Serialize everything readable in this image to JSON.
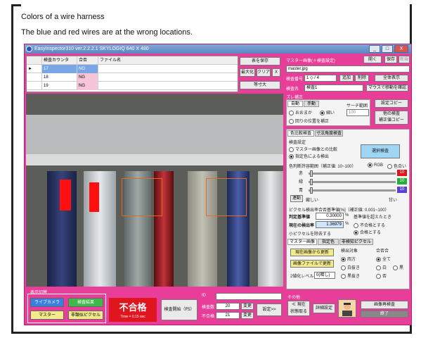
{
  "caption": {
    "line1": "Colors of a wire harness",
    "line2": "The blue and red wires are at the wrong locations."
  },
  "window": {
    "title": "EasyInspector310 ver.2.2.2.1 SKYLOGIQ 640 X 480",
    "min": "_",
    "max": "□",
    "close": "X"
  },
  "grid": {
    "headers": [
      "",
      "検査カウンタ",
      "合否",
      "ファイル名"
    ],
    "rows": [
      {
        "marker": "►",
        "counter": "17",
        "result": "NG",
        "file": ""
      },
      {
        "marker": "",
        "counter": "18",
        "result": "NG",
        "file": ""
      },
      {
        "marker": "",
        "counter": "19",
        "result": "NG",
        "file": ""
      }
    ]
  },
  "image_toolbar": {
    "save": "表を保存",
    "zoom": "最大化",
    "clear": "クリア",
    "x": "X",
    "scale": "等寸大"
  },
  "bottom": {
    "display_switch_label": "表示切替",
    "live": "ライブカメラ",
    "inspect_result": "検査結果",
    "master": "マスター",
    "mismatch_pixels": "非類似ピクセル",
    "result_text": "不合格",
    "time_text": "Time = 0.15 sec",
    "start_button": "検査開始（F5）",
    "id_label": "ID",
    "count_label": "検査数",
    "count_value": "20",
    "ng_label": "不合格",
    "ng_value": "21",
    "fix1": "変更",
    "fix2": "変更",
    "settings": "設定>>"
  },
  "right": {
    "master_image_label": "マスター画像(＋検査設定)",
    "open": "開く",
    "save": "保存",
    "new": "新規",
    "file": "master.jpg",
    "insp_no_label": "検査番号",
    "insp_no": "1 ◇ / 4",
    "add": "追加",
    "delete": "削除",
    "show_all": "全体表示",
    "insp_name_label": "検査名",
    "insp_name": "検査1",
    "mouse_move": "マウスで移動を確認",
    "shift_label": "ズレ補正",
    "auto_tab": "自動",
    "manual_tab": "手動",
    "search_range_label": "サーチ範囲",
    "search_range": "100",
    "coarse": "おおまか",
    "fine": "細い",
    "rot": "回りの位置を補正",
    "setting_copy": "設定コピー",
    "other_copy": "他の検査\n補正値コピー",
    "tabs": {
      "color": "色比較検査",
      "dim": "寸法角度検査"
    },
    "insp_setting": "検査設定",
    "master_compare": "マスター画像との比較",
    "specified_color": "指定色による検出",
    "color_select": "選択検査",
    "color_range_label": "色判断許容範囲（補正値: 10~100）",
    "rgb": "RGB",
    "hue": "色合い",
    "r_label": "赤",
    "g_label": "緑",
    "b_label": "青",
    "r_val": "10",
    "g_val": "10",
    "b_val": "10",
    "link": "連動",
    "strict": "厳しい",
    "loose": "甘い",
    "pixel_label": "ピクセル検出率合否基準値[%]（補正値: 0.001~100）",
    "judge_label": "判定基準値",
    "judge_value": "0.30000",
    "pct": "%",
    "base_above": "基準値を超えたとき",
    "current_label": "現在の検出率",
    "current_value": "1.36979",
    "fail": "不合格とする",
    "pass": "合格とする",
    "small_px": "小ピクセルを除去する",
    "subtabs": [
      "マスター画像",
      "指定色",
      "非検知ピクセル"
    ],
    "create_from_img": "現在画像から更新",
    "create_from_file": "画像ファイルで更新",
    "detect_label": "検出対象",
    "both": "両方",
    "light": "白抜き",
    "dark": "黒抜き",
    "judge_pass": "合否合",
    "all": "全て",
    "black": "白",
    "white": "黒",
    "dark2": "否",
    "bin_level": "2値化レベル",
    "bin_value": "0(暗し)",
    "other": "その他",
    "prev": "≪ 現在\n状態取る",
    "detail": "詳細設定",
    "reinspect": "画像再検査",
    "finish": "終了"
  },
  "colors": {
    "pink": "#e83e9a",
    "red": "#e0161e",
    "live": "#3a7fe0",
    "result": "#3fb84a",
    "master": "#f3ea8e"
  }
}
